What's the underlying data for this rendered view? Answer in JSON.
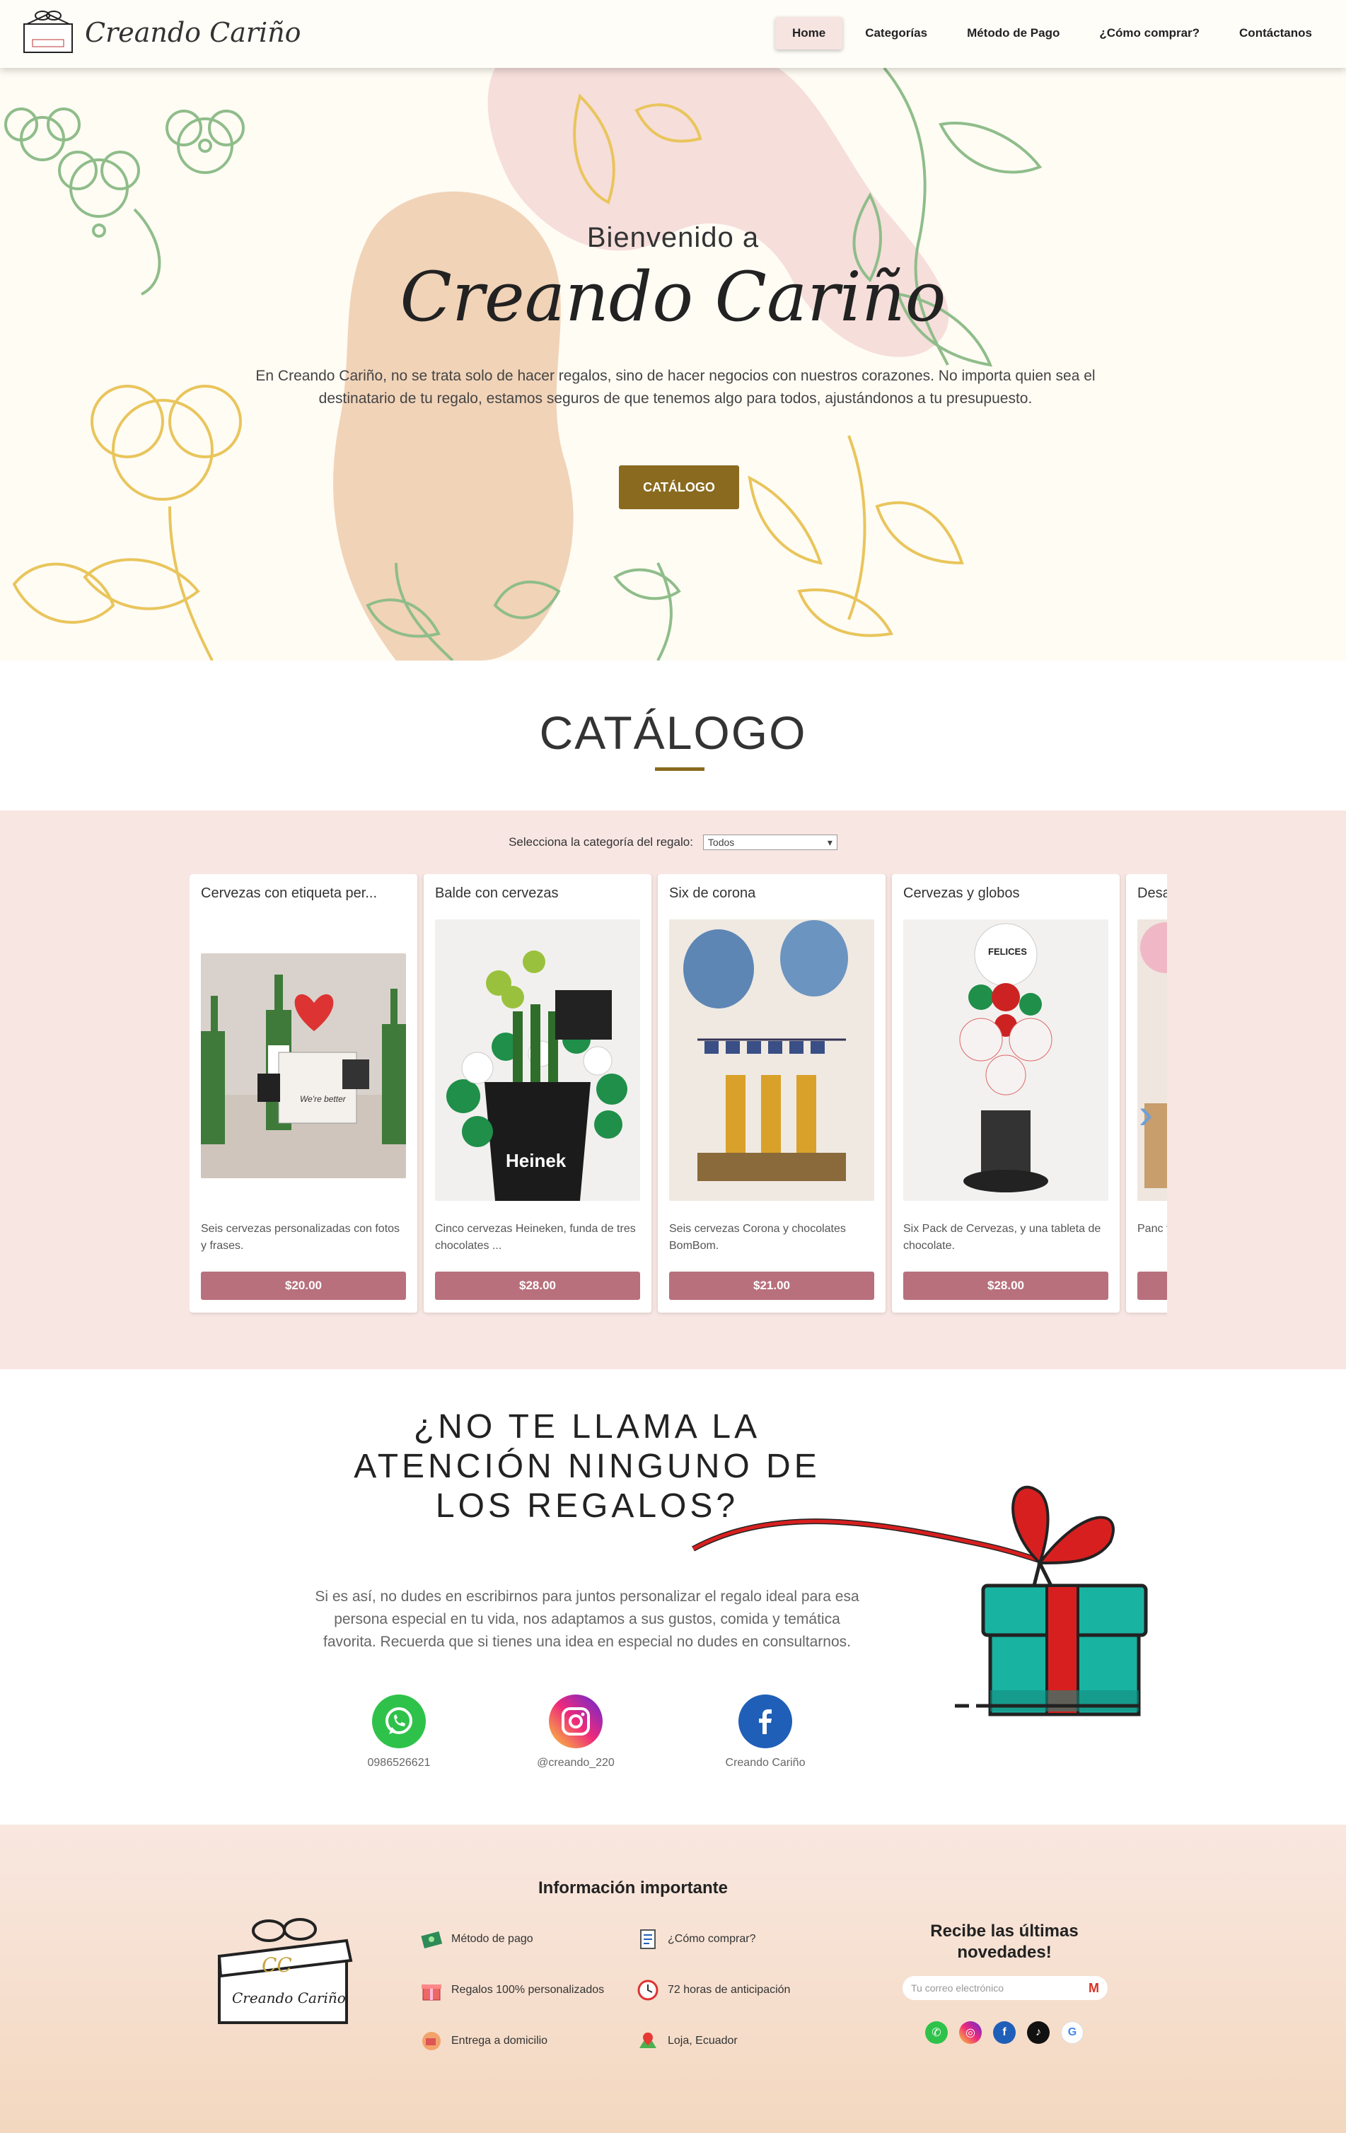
{
  "nav": {
    "brand": "Creando Cariño",
    "links": [
      "Home",
      "Categorías",
      "Método de Pago",
      "¿Cómo comprar?",
      "Contáctanos"
    ]
  },
  "hero": {
    "welcome": "Bienvenido a",
    "brand": "Creando Cariño",
    "text": "En Creando Cariño, no se trata solo de hacer regalos, sino de hacer negocios con nuestros corazones. No importa quien sea el destinatario de tu regalo, estamos seguros de que tenemos algo para todos, ajustándonos a tu presupuesto.",
    "button": "CATÁLOGO"
  },
  "catalog": {
    "title": "CATÁLOGO",
    "filter_label": "Selecciona la categoría del regalo:",
    "filter_value": "Todos",
    "products": [
      {
        "title": "Cervezas con etiqueta per...",
        "desc": "Seis cervezas personalizadas con fotos y frases.",
        "price": "$20.00"
      },
      {
        "title": "Balde con cervezas",
        "desc": "Cinco cervezas Heineken, funda de tres chocolates ...",
        "price": "$28.00"
      },
      {
        "title": "Six de corona",
        "desc": "Seis cervezas Corona y chocolates BomBom.",
        "price": "$21.00"
      },
      {
        "title": "Cervezas y globos",
        "desc": "Six Pack de Cervezas, y una tableta de chocolate.",
        "price": "$28.00"
      },
      {
        "title": "Desa",
        "desc": "Panc tigrill",
        "price": ""
      }
    ]
  },
  "contact": {
    "title": "¿NO TE LLAMA LA ATENCIÓN NINGUNO DE LOS REGALOS?",
    "text": "Si es así, no dudes en escribirnos para juntos personalizar el regalo ideal para esa persona especial en tu vida, nos adaptamos a sus gustos, comida y temática favorita. Recuerda que si tienes una idea en especial no dudes en consultarnos.",
    "whatsapp": "0986526621",
    "instagram": "@creando_220",
    "facebook": "Creando Cariño"
  },
  "footer": {
    "title": "Información importante",
    "logo_text": "Creando Cariño",
    "items": [
      "Método de pago",
      "¿Cómo comprar?",
      "Regalos 100% personalizados",
      "72 horas de anticipación",
      "Entrega a domicilio",
      "Loja, Ecuador"
    ],
    "newsletter_title": "Recibe las últimas novedades!",
    "email_placeholder": "Tu correo electrónico"
  },
  "colors": {
    "accent": "#8a6a1f",
    "price": "#b8707c",
    "catalog_bg": "#f8e6e3",
    "hero_bg": "#fffcf4"
  }
}
